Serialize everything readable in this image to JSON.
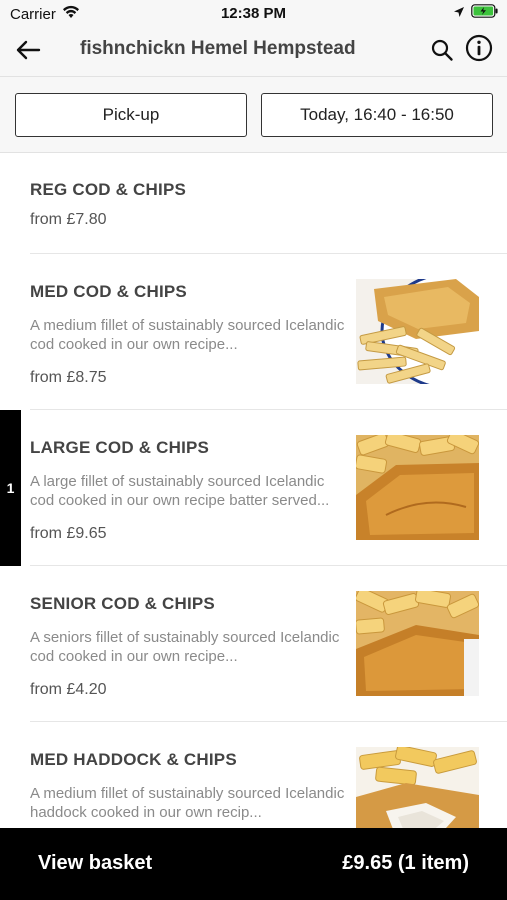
{
  "status_bar": {
    "carrier": "Carrier",
    "time": "12:38 PM"
  },
  "header": {
    "title": "fishnchickn Hemel Hempstead",
    "back_icon": "arrow-left-icon",
    "search_icon": "search-icon",
    "info_icon": "info-icon"
  },
  "options": {
    "fulfilment": "Pick-up",
    "time_slot": "Today, 16:40 - 16:50"
  },
  "menu": {
    "items": [
      {
        "name": "REG COD & CHIPS",
        "description": "",
        "price": "from £7.80"
      },
      {
        "name": "MED COD & CHIPS",
        "description": "A medium fillet of sustainably sourced Icelandic cod cooked in our own recipe...",
        "price": "from £8.75"
      },
      {
        "name": "LARGE COD & CHIPS",
        "description": "A large fillet of sustainably sourced Icelandic cod cooked in our own recipe batter served...",
        "price": "from £9.65"
      },
      {
        "name": "SENIOR COD & CHIPS",
        "description": "A seniors fillet of sustainably sourced Icelandic cod cooked in our own recipe...",
        "price": "from £4.20"
      },
      {
        "name": "MED HADDOCK & CHIPS",
        "description": "A medium fillet of sustainably sourced Icelandic haddock cooked in our own recip...",
        "price": ""
      }
    ],
    "quantity_badge": "1"
  },
  "basket": {
    "label": "View basket",
    "total": "£9.65 (1 item)"
  },
  "colors": {
    "accent": "#000000",
    "battery": "#3cc23c"
  }
}
